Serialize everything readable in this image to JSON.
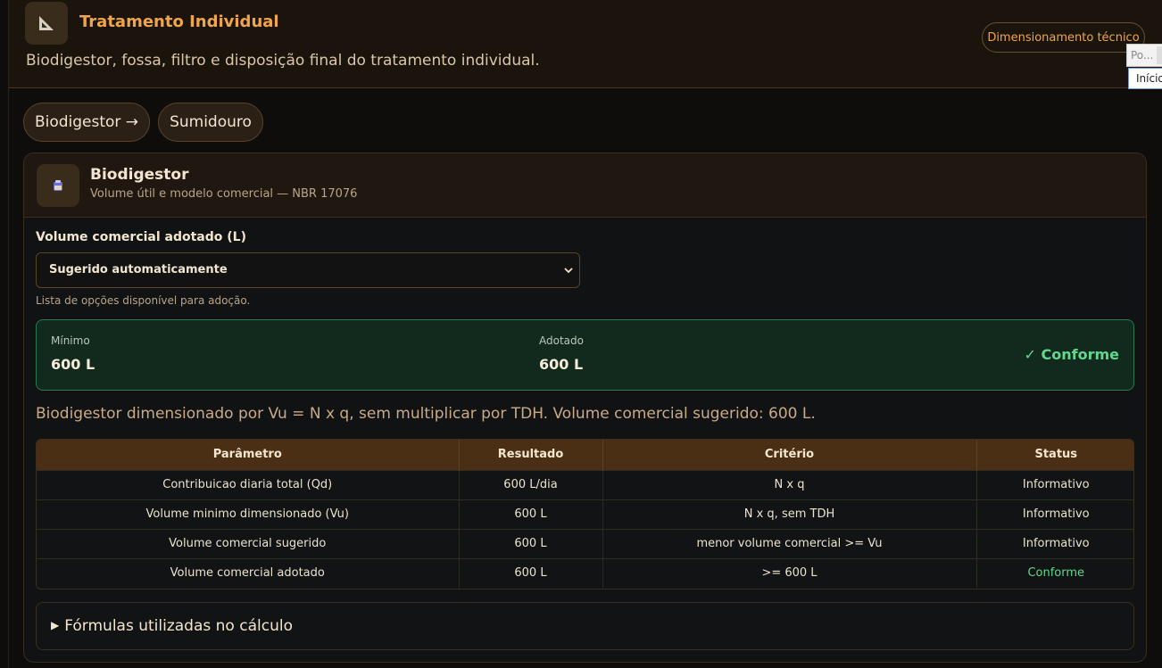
{
  "header": {
    "icon": "set-square-icon",
    "title": "Tratamento Individual",
    "subtitle": "Biodigestor, fossa, filtro e disposição final do tratamento individual.",
    "tech_button": "Dimensionamento técnico"
  },
  "popup": {
    "input_text": "Po...",
    "button_text": "Início"
  },
  "tabs": [
    {
      "label": "Biodigestor →",
      "active": true
    },
    {
      "label": "Sumidouro",
      "active": false
    }
  ],
  "card": {
    "icon": "tank-icon",
    "title": "Biodigestor",
    "subtitle": "Volume útil e modelo comercial — NBR 17076",
    "field_label": "Volume comercial adotado (L)",
    "select_value": "Sugerido automaticamente",
    "hint": "Lista de opções disponível para adoção.",
    "summary": {
      "min_label": "Mínimo",
      "min_value": "600 L",
      "adopted_label": "Adotado",
      "adopted_value": "600 L",
      "status": "✓ Conforme"
    },
    "note": "Biodigestor dimensionado por Vu = N x q, sem multiplicar por TDH. Volume comercial sugerido: 600 L.",
    "table": {
      "headers": [
        "Parâmetro",
        "Resultado",
        "Critério",
        "Status"
      ],
      "rows": [
        [
          "Contribuicao diaria total (Qd)",
          "600 L/dia",
          "N x q",
          "Informativo"
        ],
        [
          "Volume minimo dimensionado (Vu)",
          "600 L",
          "N x q, sem TDH",
          "Informativo"
        ],
        [
          "Volume comercial sugerido",
          "600 L",
          "menor volume comercial >= Vu",
          "Informativo"
        ],
        [
          "Volume comercial adotado",
          "600 L",
          ">= 600 L",
          "Conforme"
        ]
      ]
    },
    "formulas_label": "Fórmulas utilizadas no cálculo"
  },
  "colors": {
    "accent": "#f0a54a",
    "success": "#62d88e",
    "background": "#0e0d0c"
  }
}
